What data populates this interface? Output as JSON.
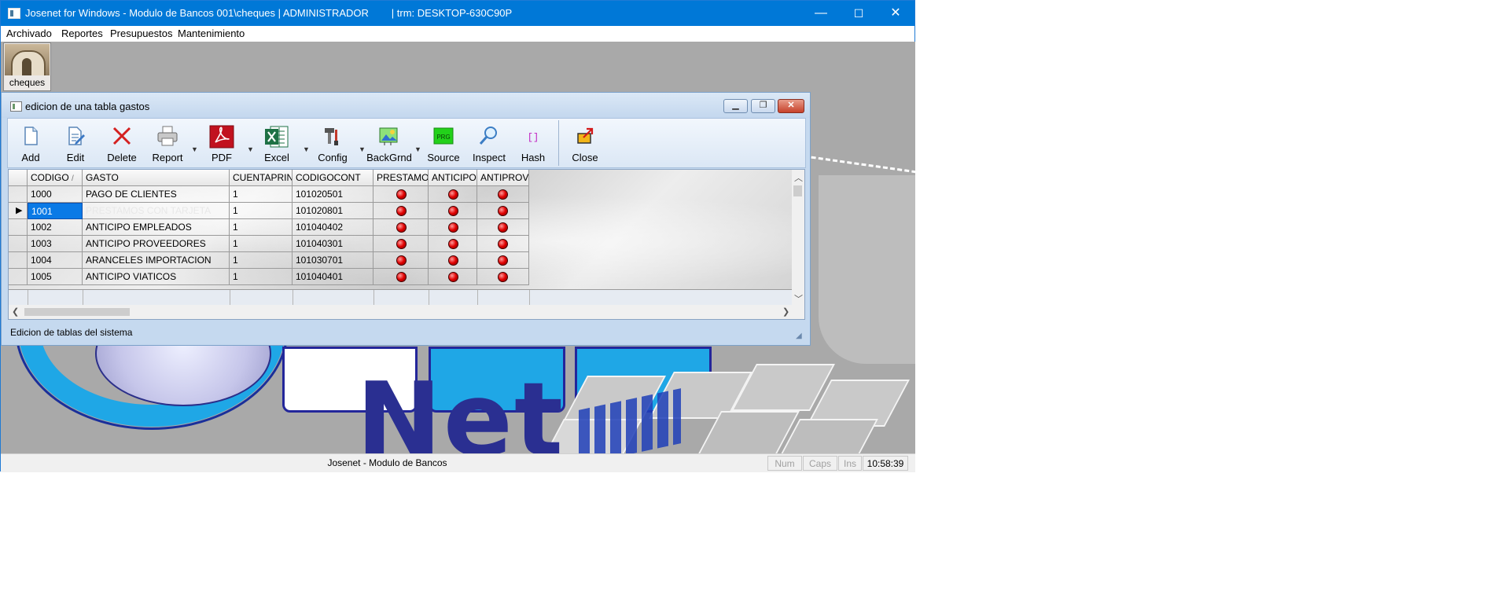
{
  "window": {
    "title": "Josenet for Windows - Modulo de Bancos 001\\cheques | ADMINISTRADOR        | trm: DESKTOP-630C90P",
    "minimize": "—",
    "maximize": "☐",
    "close": "✕"
  },
  "menu": [
    "Archivado",
    "Reportes",
    "Presupuestos",
    "Mantenimiento"
  ],
  "desktop": {
    "shortcut_label": "cheques",
    "logo_text": "Net"
  },
  "child": {
    "title": "edicion de una tabla gastos",
    "toolbar": [
      "Add",
      "Edit",
      "Delete",
      "Report",
      "PDF",
      "Excel",
      "Config",
      "BackGrnd",
      "Source",
      "Inspect",
      "Hash",
      "Close"
    ],
    "status": "Edicion de tablas del sistema"
  },
  "grid": {
    "columns": [
      "CODIGO",
      "GASTO",
      "CUENTAPRIN",
      "CODIGOCONT",
      "PRESTAMO",
      "ANTICIPO",
      "ANTIPROV"
    ],
    "sort_indicator": "/",
    "rows": [
      {
        "codigo": "1000",
        "gasto": "PAGO DE CLIENTES",
        "cuentaprin": "1",
        "codigocont": "101020501",
        "prestamo": true,
        "anticipo": true,
        "antiprov": true
      },
      {
        "codigo": "1001",
        "gasto": "PRESTAMOS CON TARJETA",
        "cuentaprin": "1",
        "codigocont": "101020801",
        "prestamo": true,
        "anticipo": true,
        "antiprov": true,
        "selected": true
      },
      {
        "codigo": "1002",
        "gasto": "ANTICIPO EMPLEADOS",
        "cuentaprin": "1",
        "codigocont": "101040402",
        "prestamo": true,
        "anticipo": true,
        "antiprov": true
      },
      {
        "codigo": "1003",
        "gasto": "ANTICIPO PROVEEDORES",
        "cuentaprin": "1",
        "codigocont": "101040301",
        "prestamo": true,
        "anticipo": true,
        "antiprov": true
      },
      {
        "codigo": "1004",
        "gasto": "ARANCELES IMPORTACION",
        "cuentaprin": "1",
        "codigocont": "101030701",
        "prestamo": true,
        "anticipo": true,
        "antiprov": true
      },
      {
        "codigo": "1005",
        "gasto": "ANTICIPO VIATICOS",
        "cuentaprin": "1",
        "codigocont": "101040401",
        "prestamo": true,
        "anticipo": true,
        "antiprov": true
      }
    ]
  },
  "statusbar": {
    "text": "Josenet - Modulo de Bancos",
    "num": "Num",
    "caps": "Caps",
    "ins": "Ins",
    "time": "10:58:39"
  },
  "colors": {
    "titlebar": "#0078d7",
    "selection": "#0a7ae6",
    "logo_blue": "#1fa7e6",
    "logo_navy": "#2a2f91"
  }
}
